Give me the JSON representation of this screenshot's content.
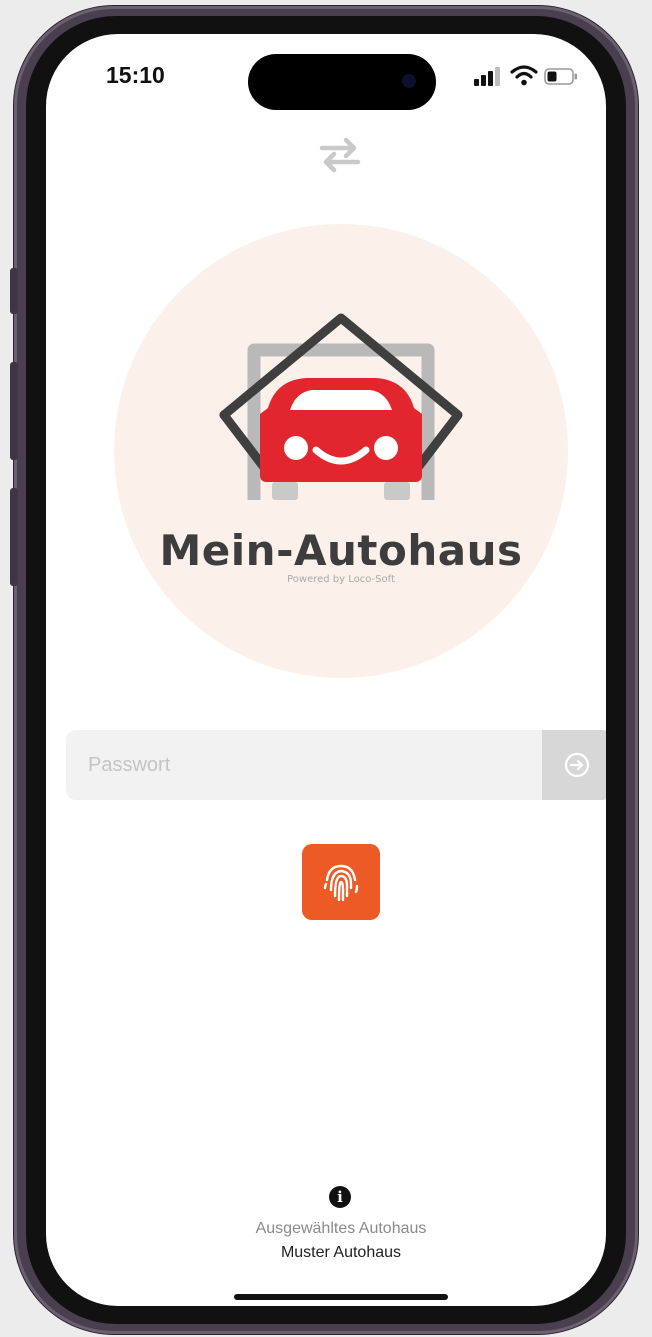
{
  "status_bar": {
    "time": "15:10"
  },
  "logo": {
    "title": "Mein-Autohaus",
    "subtitle": "Powered by Loco-Soft"
  },
  "login": {
    "password_placeholder": "Passwort",
    "password_value": ""
  },
  "dealership": {
    "label": "Ausgewähltes Autohaus",
    "name": "Muster Autohaus"
  },
  "icons": {
    "swap": "swap-arrows-icon",
    "submit": "arrow-right-circle-icon",
    "fingerprint": "fingerprint-icon",
    "info": "info-icon"
  },
  "colors": {
    "accent": "#ec5a25",
    "logo_car": "#e1262d",
    "logo_background": "#fcf0ea"
  }
}
